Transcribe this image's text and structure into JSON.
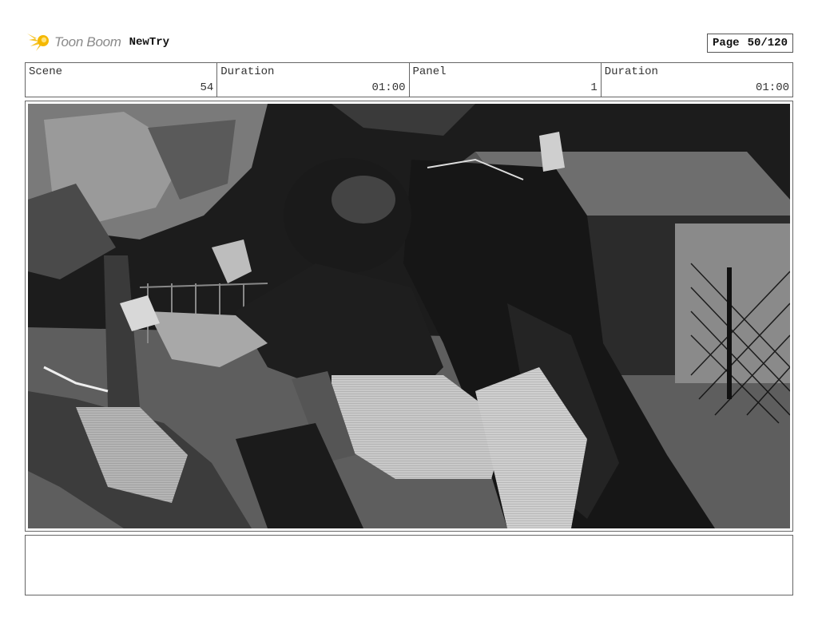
{
  "header": {
    "brand": "Toon Boom",
    "project": "NewTry",
    "page_label": "Page",
    "page_value": "50/120"
  },
  "info": {
    "scene_label": "Scene",
    "scene_value": "54",
    "duration_label": "Duration",
    "duration_value": "01:00",
    "panel_label": "Panel",
    "panel_value": "1",
    "panel_duration_label": "Duration",
    "panel_duration_value": "01:00"
  },
  "colors": {
    "logo_accent": "#f5b800",
    "border": "#666666"
  },
  "icons": {
    "logo": "toon-boom-star-icon"
  }
}
